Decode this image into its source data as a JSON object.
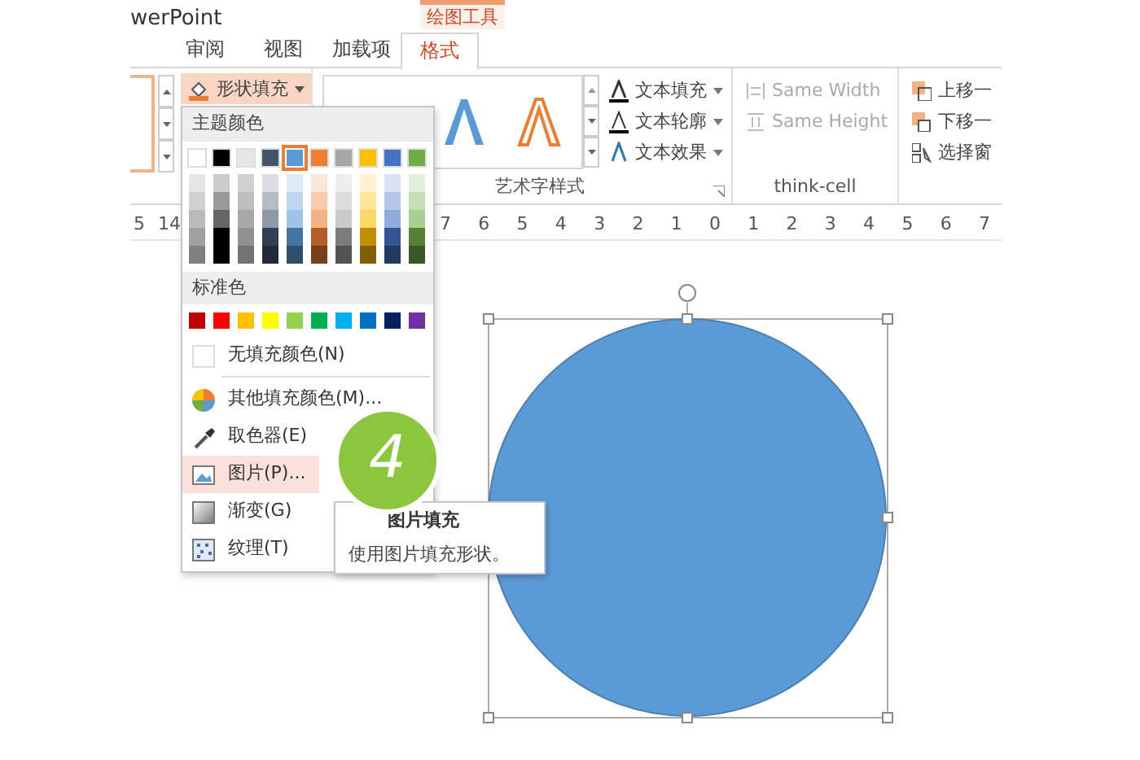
{
  "window": {
    "title": "werPoint"
  },
  "context_tab_group": "绘图工具",
  "tabs": [
    {
      "label": "审阅",
      "selected": false
    },
    {
      "label": "视图",
      "selected": false
    },
    {
      "label": "加载项",
      "selected": false
    },
    {
      "label": "格式",
      "selected": true
    }
  ],
  "ribbon": {
    "shape_fill_button": "形状填充",
    "wordart_group": {
      "label": "艺术字样式",
      "buttons": [
        "文本填充",
        "文本轮廓",
        "文本效果"
      ]
    },
    "thinkcell_group": {
      "label": "think-cell",
      "buttons": [
        "Same Width",
        "Same Height"
      ]
    },
    "arrange_group": {
      "buttons": [
        "上移一",
        "下移一",
        "选择窗"
      ]
    }
  },
  "ruler": {
    "left_labels": [
      "5",
      "14"
    ],
    "labels": [
      "7",
      "6",
      "5",
      "4",
      "3",
      "2",
      "1",
      "0",
      "1",
      "2",
      "3",
      "4",
      "5",
      "6",
      "7"
    ]
  },
  "fill_menu": {
    "theme_header": "主题颜色",
    "theme_colors": [
      {
        "color": "#ffffff",
        "selected": false
      },
      {
        "color": "#000000",
        "selected": false
      },
      {
        "color": "#e7e6e6",
        "selected": false
      },
      {
        "color": "#44546a",
        "selected": false
      },
      {
        "color": "#5b9bd5",
        "selected": true
      },
      {
        "color": "#ed7d31",
        "selected": false
      },
      {
        "color": "#a5a5a5",
        "selected": false
      },
      {
        "color": "#ffc000",
        "selected": false
      },
      {
        "color": "#4472c4",
        "selected": false
      },
      {
        "color": "#70ad47",
        "selected": false
      }
    ],
    "standard_header": "标准色",
    "standard_colors": [
      {
        "color": "#c00000"
      },
      {
        "color": "#ff0000"
      },
      {
        "color": "#ffc000"
      },
      {
        "color": "#ffff00"
      },
      {
        "color": "#92d050"
      },
      {
        "color": "#00b050"
      },
      {
        "color": "#00b0f0"
      },
      {
        "color": "#0070c0"
      },
      {
        "color": "#002060"
      },
      {
        "color": "#7030a0"
      }
    ],
    "no_fill": "无填充颜色(N)",
    "items": [
      {
        "kind": "palette",
        "label": "其他填充颜色(M)...",
        "selected": false
      },
      {
        "kind": "eyedropper",
        "label": "取色器(E)",
        "selected": false
      },
      {
        "kind": "picture",
        "label": "图片(P)...",
        "selected": true
      },
      {
        "kind": "gradient",
        "label": "渐变(G)",
        "selected": false
      },
      {
        "kind": "texture",
        "label": "纹理(T)",
        "selected": false
      }
    ]
  },
  "tooltip": {
    "title": "图片填充",
    "description": "使用图片填充形状。"
  },
  "step_badge": "4"
}
